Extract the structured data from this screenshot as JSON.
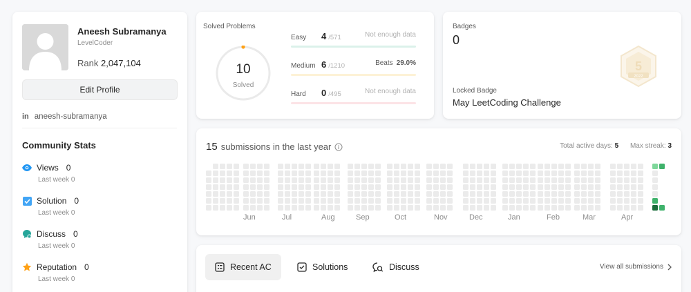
{
  "profile": {
    "name": "Aneesh Subramanya",
    "handle": "LevelCoder",
    "rank_label": "Rank",
    "rank_value": "2,047,104",
    "edit_button": "Edit Profile",
    "linkedin_icon": "linkedin-icon",
    "linkedin": "aneesh-subramanya"
  },
  "community": {
    "title": "Community Stats",
    "items": [
      {
        "icon": "eye-icon",
        "label": "Views",
        "value": "0",
        "sub_label": "Last week",
        "sub_value": "0",
        "color": "#2196f3"
      },
      {
        "icon": "solution-check-icon",
        "label": "Solution",
        "value": "0",
        "sub_label": "Last week",
        "sub_value": "0",
        "color": "#42a5f5"
      },
      {
        "icon": "discuss-icon",
        "label": "Discuss",
        "value": "0",
        "sub_label": "Last week",
        "sub_value": "0",
        "color": "#26a69a"
      },
      {
        "icon": "star-icon",
        "label": "Reputation",
        "value": "0",
        "sub_label": "Last week",
        "sub_value": "0",
        "color": "#ffa116"
      }
    ]
  },
  "solved": {
    "title": "Solved Problems",
    "total": "10",
    "total_label": "Solved",
    "difficulties": [
      {
        "name": "Easy",
        "count": "4",
        "total": "/571",
        "note": "Not enough data",
        "beats": "",
        "color": "#00af9b",
        "track": "#dbf1ea",
        "fraction": 0.007
      },
      {
        "name": "Medium",
        "count": "6",
        "total": "/1210",
        "note": "Beats",
        "beats": "29.0%",
        "color": "#ffb800",
        "track": "#fdf2d6",
        "fraction": 0.005
      },
      {
        "name": "Hard",
        "count": "0",
        "total": "/495",
        "note": "Not enough data",
        "beats": "",
        "color": "#ff2d55",
        "track": "#fce3e6",
        "fraction": 0.0
      }
    ]
  },
  "badges": {
    "label": "Badges",
    "count": "0",
    "locked_label": "Locked Badge",
    "locked_name": "May LeetCoding Challenge",
    "badge_icon": "may-challenge-badge-icon",
    "badge_text": "5",
    "badge_year": "2022"
  },
  "submissions": {
    "count": "15",
    "label": "submissions in the last year",
    "info_icon": "info-icon",
    "active_days_label": "Total active days:",
    "active_days": "5",
    "max_streak_label": "Max streak:",
    "max_streak": "3",
    "months": [
      "Jun",
      "Jul",
      "Aug",
      "Sep",
      "Oct",
      "Nov",
      "Dec",
      "Jan",
      "Feb",
      "Mar",
      "Apr"
    ],
    "colors": {
      "empty": "#ebebeb",
      "light": "#7ed79a",
      "mid": "#3fb26b",
      "dark": "#196c3a"
    }
  },
  "recent": {
    "tabs": [
      {
        "label": "Recent AC",
        "icon": "list-icon",
        "active": true
      },
      {
        "label": "Solutions",
        "icon": "check-square-icon",
        "active": false
      },
      {
        "label": "Discuss",
        "icon": "chat-search-icon",
        "active": false
      }
    ],
    "view_all": "View all submissions",
    "chevron_icon": "chevron-right-icon"
  }
}
